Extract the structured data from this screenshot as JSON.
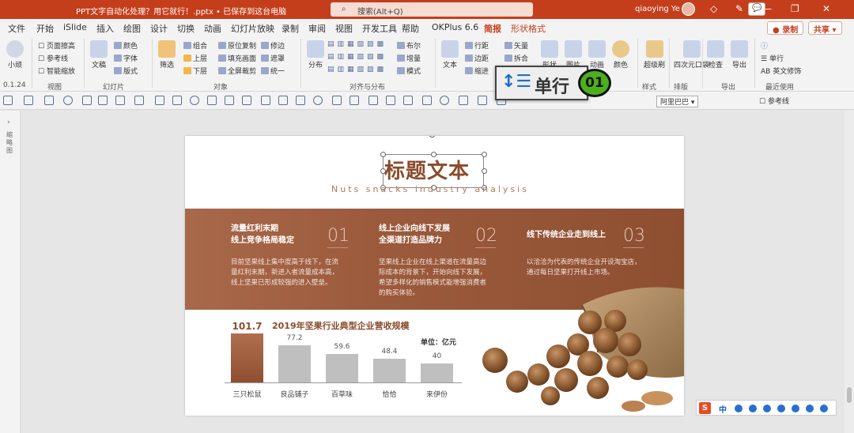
{
  "window": {
    "doc_title": "PPT文字自动化处理？用它就行！.pptx • 已保存到这台电脑",
    "search_placeholder": "搜索(Alt+Q)",
    "user_name": "qiaoying Ye"
  },
  "tabs": [
    "文件",
    "开始",
    "iSlide",
    "插入",
    "绘图",
    "设计",
    "切换",
    "动画",
    "幻灯片放映",
    "录制",
    "审阅",
    "视图",
    "开发工具",
    "帮助",
    "OKPlus 6.6",
    "简报",
    "形状格式"
  ],
  "active_tab": "简报",
  "title_buttons": {
    "comment": "💬",
    "record": "录制",
    "share": "共享"
  },
  "ribbon": {
    "small_btn": "小顽",
    "version": "0.1.24",
    "view_group": {
      "items": [
        "页面擦高",
        "参考线",
        "智能缩放"
      ],
      "label": "视图"
    },
    "slide_group": {
      "doc": "文稿",
      "items": [
        "颜色",
        "字体",
        "版式"
      ],
      "label": "幻灯片"
    },
    "object_group": {
      "filter": "筛选",
      "items": [
        "组合",
        "上层",
        "下层",
        "原位复制",
        "填充画面",
        "全屏裁剪",
        "修边",
        "遮罩",
        "统一"
      ],
      "label": "对象"
    },
    "align_group": {
      "distribute": "分布",
      "items": [
        "布尔",
        "增量",
        "模式"
      ],
      "label": "对齐与分布"
    },
    "text_group": {
      "text": "文本",
      "items": [
        "行距",
        "边距",
        "缩进",
        "矢量",
        "拆合"
      ],
      "shape": "形状",
      "image": "图片",
      "anim": "动画",
      "color": "颜色"
    },
    "style_group": {
      "super": "超级刷",
      "label": "样式"
    },
    "layout_group": {
      "grid": "四次元口袋",
      "label": "排版"
    },
    "export_group": {
      "check": "检查",
      "export": "导出",
      "label": "导出"
    },
    "recent_group": {
      "items": [
        "单行",
        "英文修饰"
      ],
      "label": "最近使用"
    }
  },
  "quick_access": {
    "font_name": "阿里巴巴",
    "guide": "参考线"
  },
  "left_panel": {
    "label": "缩略图"
  },
  "slide": {
    "title": "标题文本",
    "subtitle": "Nuts snacks industry analysis",
    "columns": [
      {
        "heading": [
          "流量红利末期",
          "线上竞争格局稳定"
        ],
        "num": "01",
        "body": [
          "目前坚果线上集中度高于线下，在流",
          "量红利末期，新进入者流量成本高，",
          "线上坚果已形成较强的进入壁垒。"
        ]
      },
      {
        "heading": [
          "线上企业向线下发展",
          "全渠道打造品牌力"
        ],
        "num": "02",
        "body": [
          "坚果线上企业在线上渠道在流量高边",
          "际成本的背景下，开始向线下发展，",
          "希望多样化的销售模式能增强消费者",
          "的购买体验。"
        ]
      },
      {
        "heading": [
          "线下传统企业走到线上"
        ],
        "num": "03",
        "body": [
          "以洽洽为代表的传统企业开设淘宝店，",
          "通过每日坚果打开线上市场。"
        ]
      }
    ],
    "chart_title": "2019年坚果行业典型企业营收规模",
    "unit_label": "单位：亿元"
  },
  "chart_data": {
    "type": "bar",
    "title": "2019年坚果行业典型企业营收规模",
    "categories": [
      "三只松鼠",
      "良品铺子",
      "百草味",
      "恰恰",
      "来伊份"
    ],
    "values": [
      101.7,
      77.2,
      59.6,
      48.4,
      40
    ],
    "ylim": [
      0,
      110
    ],
    "highlight_color": "#8e4f31",
    "bar_color": "#bfbfbf",
    "grid": false,
    "ylabel": "单位：亿元"
  },
  "callout": {
    "text": "单行",
    "badge": "01"
  },
  "ime": {
    "logo": "S",
    "lang": "中"
  }
}
